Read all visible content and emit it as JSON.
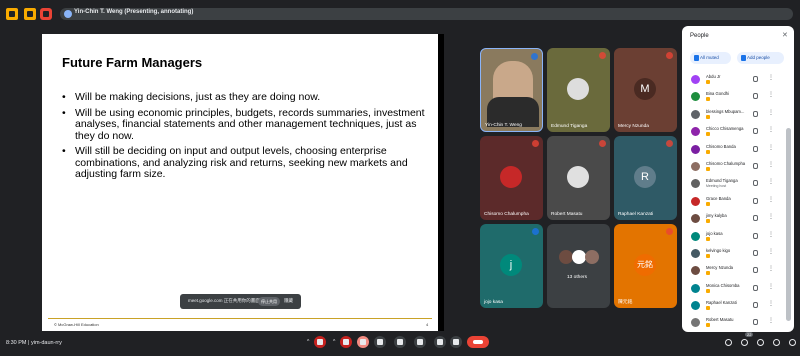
{
  "topbar": {
    "presenting_label": "Yin-Chin T. Weng (Presenting, annotating)"
  },
  "slide": {
    "title": "Future Farm Managers",
    "bullets": [
      "Will be making decisions, just as they are doing now.",
      "Will be using economic principles, budgets, records summaries, investment analyses, financial statements and other management techniques, just as they do now.",
      "Will still be deciding on input and output levels, choosing enterprise combinations, and analyzing risk and returns, seeking new markets and adjusting farm size."
    ],
    "footer": "© McGraw-Hill Education",
    "page_number": "4"
  },
  "toast": {
    "text": "meet.google.com 正在共用你的畫面。",
    "stop_label": "停止共用",
    "hide_label": "隱藏"
  },
  "tiles": [
    {
      "name": "Yin-Chin T. Weng",
      "initial": "",
      "bg": "#8a7a5e"
    },
    {
      "name": "Edmund Tiganga",
      "initial": "",
      "bg": "#6a6a3c"
    },
    {
      "name": "Mercy Nzunda",
      "initial": "M",
      "bg": "#6b3f33"
    },
    {
      "name": "Chisomo Chalumpha",
      "initial": "",
      "bg": "#5c2a2a"
    },
    {
      "name": "Robert Masatu",
      "initial": "",
      "bg": "#4a4a4a"
    },
    {
      "name": "Raphael Kanzati",
      "initial": "R",
      "bg": "#2f5a66"
    },
    {
      "name": "jojo kasa",
      "initial": "j",
      "bg": "#1f6b6b"
    },
    {
      "name": "13 others",
      "initial": "",
      "bg": "#3c4043"
    },
    {
      "name": "陳元銘",
      "initial": "元銘",
      "bg": "#e37400"
    }
  ],
  "panel": {
    "title": "People",
    "mute_all": "All muted",
    "add_people": "Add people",
    "people": [
      {
        "name": "Abdu Jr",
        "sub": "",
        "color": "#a142f4"
      },
      {
        "name": "Bina Gondhi",
        "sub": "",
        "color": "#1e8e3e"
      },
      {
        "name": "blessings Mbupam...",
        "sub": "",
        "color": "#5f6368"
      },
      {
        "name": "Chicco Chisamenga",
        "sub": "",
        "color": "#8e24aa"
      },
      {
        "name": "Chisomo Banda",
        "sub": "",
        "color": "#7b1fa2"
      },
      {
        "name": "Chisomo Chalumpha",
        "sub": "",
        "color": "#8d6e63"
      },
      {
        "name": "Edmund Tiganga",
        "sub": "Meeting host",
        "color": "#616161"
      },
      {
        "name": "Grace Banda",
        "sub": "",
        "color": "#c62828"
      },
      {
        "name": "jimy kalyba",
        "sub": "",
        "color": "#6d4c41"
      },
      {
        "name": "jojo kasa",
        "sub": "",
        "color": "#00897b"
      },
      {
        "name": "kelvingo kigo",
        "sub": "",
        "color": "#455a64"
      },
      {
        "name": "Mercy Nzunda",
        "sub": "",
        "color": "#6d4c41"
      },
      {
        "name": "Monica Chisomba",
        "sub": "",
        "color": "#00838f"
      },
      {
        "name": "Raphael Kanzati",
        "sub": "",
        "color": "#00838f"
      },
      {
        "name": "Robert Masatu",
        "sub": "",
        "color": "#757575"
      }
    ]
  },
  "bottom": {
    "clock": "8:30 PM",
    "meeting_code": "yim-daun-rry",
    "people_count": "22"
  }
}
